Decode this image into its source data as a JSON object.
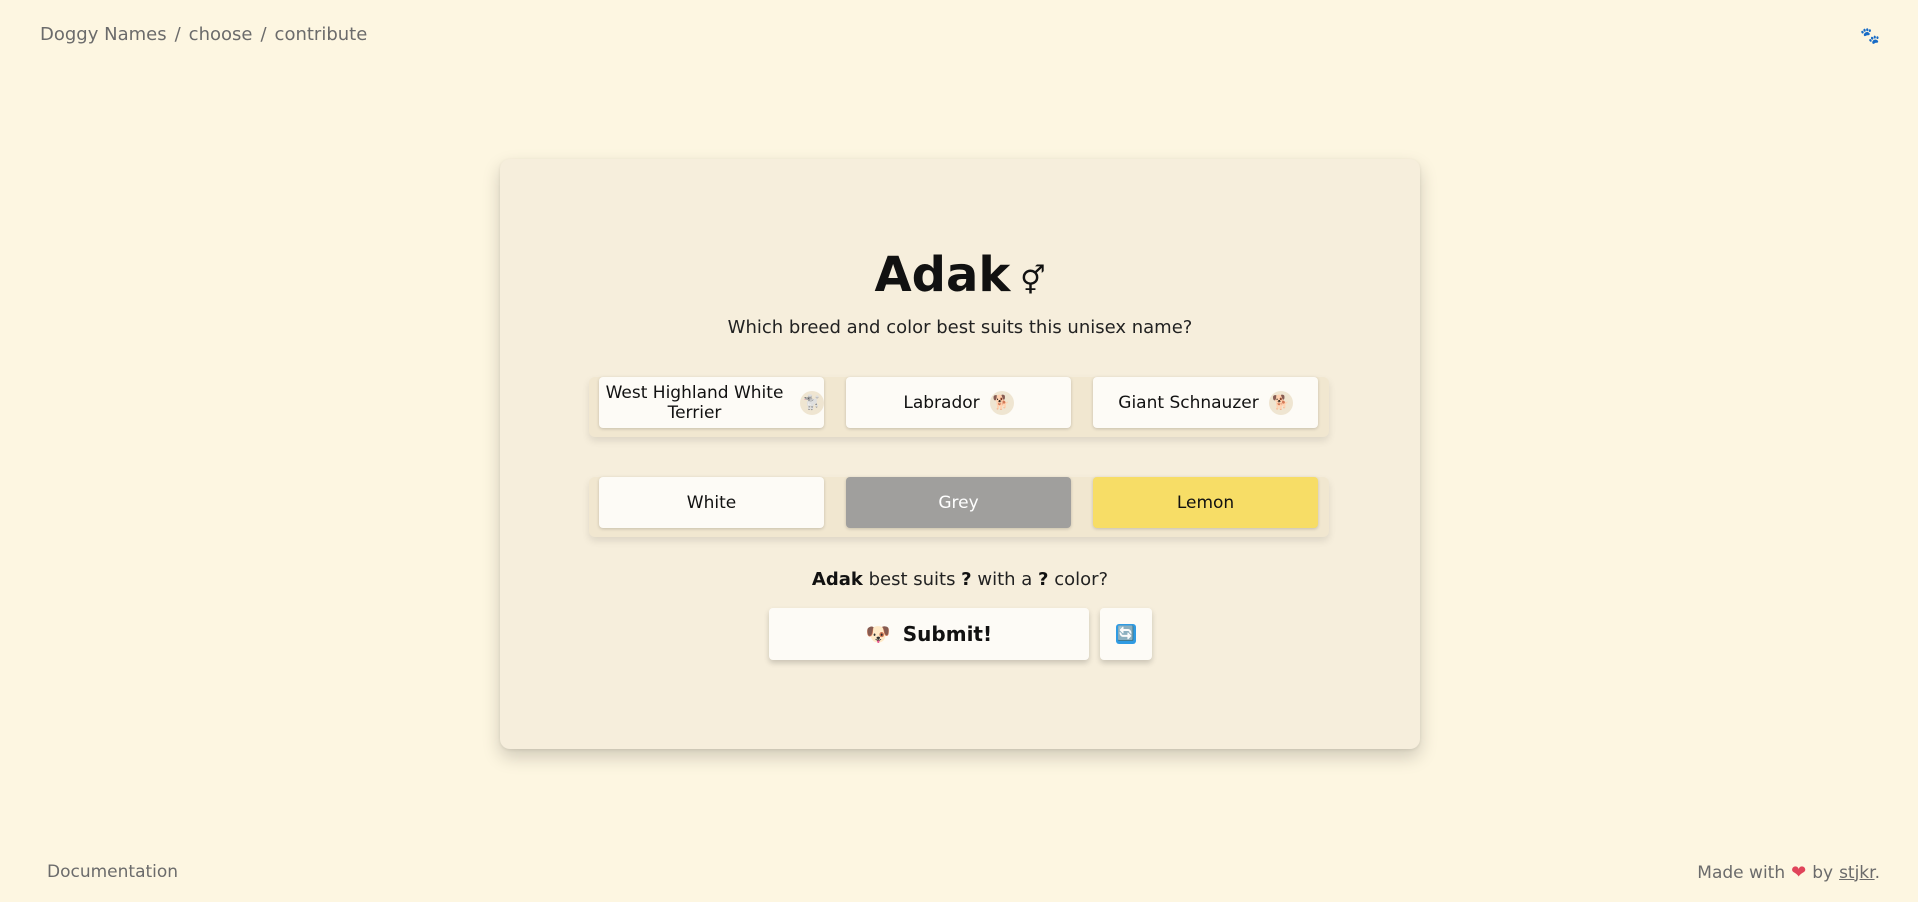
{
  "breadcrumb": {
    "home": "Doggy Names",
    "sep1": "/",
    "choose": "choose",
    "sep2": "/",
    "contribute": "contribute"
  },
  "header": {
    "paw_icon": "🐾"
  },
  "card": {
    "name": "Adak",
    "gender_symbol": "⚥",
    "question": "Which breed and color best suits this unisex name?",
    "breeds": [
      {
        "label": "West Highland White Terrier",
        "icon": "🐩"
      },
      {
        "label": "Labrador",
        "icon": "🐕"
      },
      {
        "label": "Giant Schnauzer",
        "icon": "🐕"
      }
    ],
    "colors": [
      {
        "label": "White",
        "swatch": "#fdfbf6"
      },
      {
        "label": "Grey",
        "swatch": "#a09f9d"
      },
      {
        "label": "Lemon",
        "swatch": "#f7dd66"
      }
    ],
    "summary": {
      "name": "Adak",
      "part1": " best suits ",
      "breed": "?",
      "part2": " with a ",
      "color": "?",
      "part3": " color?"
    },
    "submit_emoji": "🐶",
    "submit_label": "Submit!",
    "refresh_icon": "🔄"
  },
  "footer": {
    "documentation": "Documentation",
    "made_with": "Made with",
    "heart": "❤",
    "by": "by",
    "author": "stjkr",
    "period": "."
  }
}
